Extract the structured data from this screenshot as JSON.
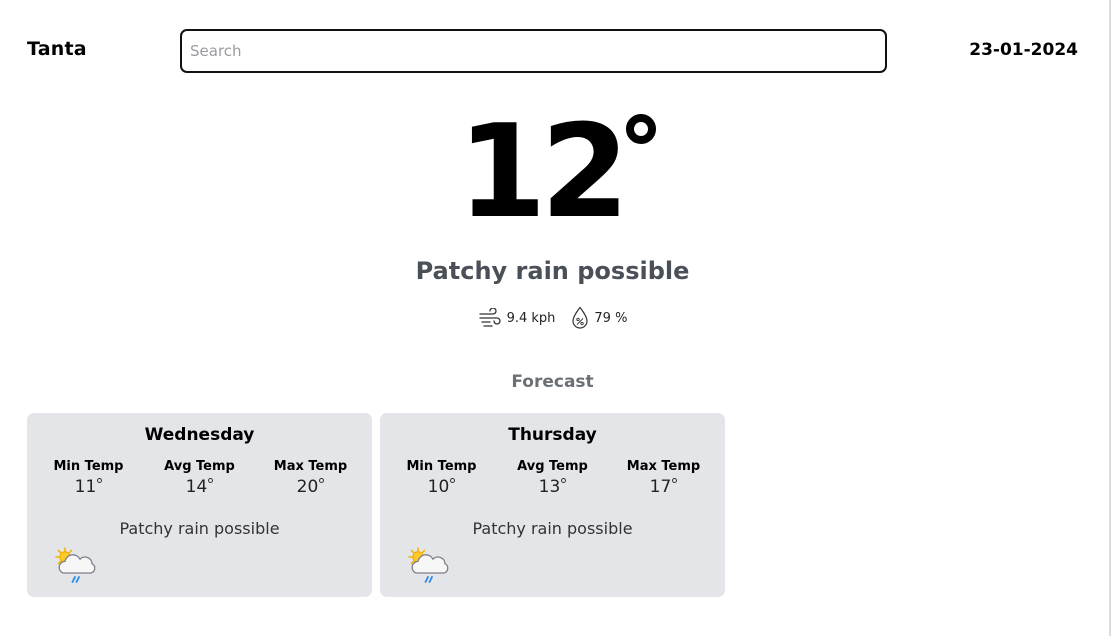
{
  "header": {
    "city": "Tanta",
    "search_placeholder": "Search",
    "search_value": "",
    "date": "23-01-2024"
  },
  "current": {
    "temperature": "12",
    "condition": "Patchy rain possible",
    "wind": "9.4 kph",
    "humidity": "79 %",
    "wind_icon": "wind-icon",
    "humidity_icon": "humidity-icon"
  },
  "forecast": {
    "title": "Forecast",
    "days": [
      {
        "day": "Wednesday",
        "min_label": "Min Temp",
        "avg_label": "Avg Temp",
        "max_label": "Max Temp",
        "min": "11",
        "avg": "14",
        "max": "20",
        "condition": "Patchy rain possible",
        "icon": "patchy-rain-icon"
      },
      {
        "day": "Thursday",
        "min_label": "Min Temp",
        "avg_label": "Avg Temp",
        "max_label": "Max Temp",
        "min": "10",
        "avg": "13",
        "max": "17",
        "condition": "Patchy rain possible",
        "icon": "patchy-rain-icon"
      }
    ]
  },
  "colors": {
    "card_bg": "#e4e5e9",
    "condition_text": "#4a5057",
    "forecast_title": "#6b7076"
  }
}
